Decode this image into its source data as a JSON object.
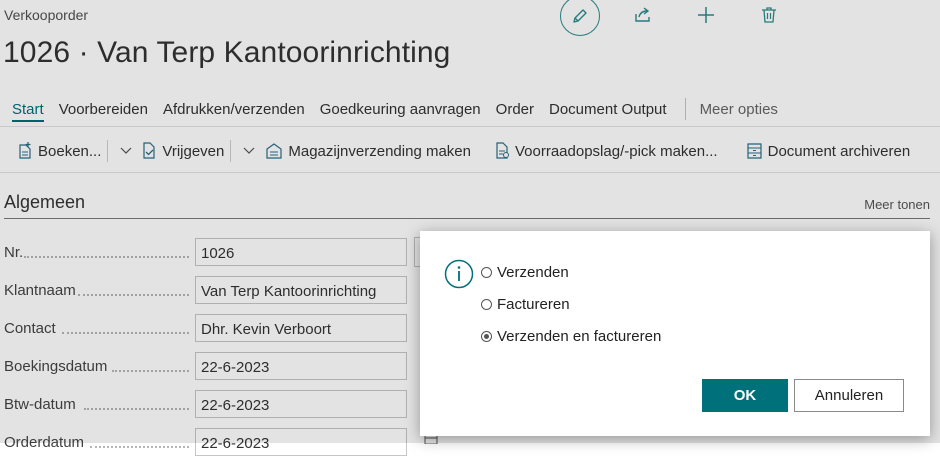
{
  "page": {
    "type": "Verkooporder",
    "title": "1026 · Van Terp Kantoorinrichting"
  },
  "top_actions": [
    "pencil-icon",
    "share-icon",
    "plus-icon",
    "trash-icon"
  ],
  "action_tabs": {
    "items": [
      "Start",
      "Voorbereiden",
      "Afdrukken/verzenden",
      "Goedkeuring aanvragen",
      "Order",
      "Document Output"
    ],
    "active": "Start",
    "more": "Meer opties"
  },
  "toolbar": {
    "post": "Boeken...",
    "release": "Vrijgeven",
    "warehouse_shipment": "Magazijnverzending maken",
    "inventory_pick": "Voorraadopslag/-pick maken...",
    "archive": "Document archiveren"
  },
  "section": {
    "title": "Algemeen",
    "show_more": "Meer tonen"
  },
  "fields": [
    {
      "label": "Nr.",
      "value": "1026"
    },
    {
      "label": "Klantnaam",
      "value": "Van Terp Kantoorinrichting"
    },
    {
      "label": "Contact",
      "value": "Dhr. Kevin Verboort"
    },
    {
      "label": "Boekingsdatum",
      "value": "22-6-2023"
    },
    {
      "label": "Btw-datum",
      "value": "22-6-2023"
    },
    {
      "label": "Orderdatum",
      "value": "22-6-2023"
    }
  ],
  "dialog": {
    "options": [
      "Verzenden",
      "Factureren",
      "Verzenden en factureren"
    ],
    "selected": "Verzenden en factureren",
    "ok": "OK",
    "cancel": "Annuleren"
  },
  "colors": {
    "accent": "#00707a",
    "overlay": "rgba(0,0,0,0.11)"
  }
}
